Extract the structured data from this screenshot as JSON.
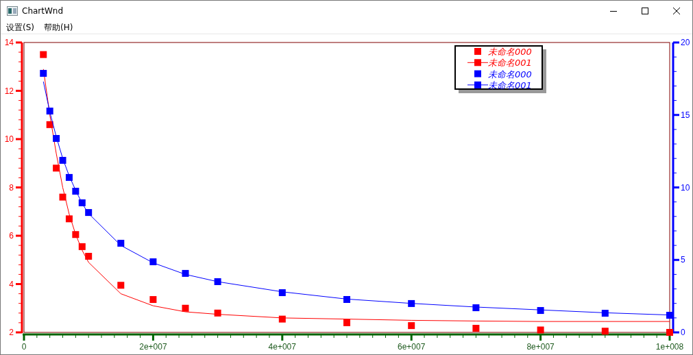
{
  "window": {
    "title": "ChartWnd"
  },
  "menu": [
    {
      "label": "设置(S)"
    },
    {
      "label": "帮助(H)"
    }
  ],
  "chart": {
    "chart_data": {
      "type": "scatter",
      "x": [
        3000000,
        4000000,
        5000000,
        6000000,
        7000000,
        8000000,
        9000000,
        10000000,
        15000000,
        20000000,
        25000000,
        30000000,
        40000000,
        50000000,
        60000000,
        70000000,
        80000000,
        90000000,
        100000000
      ],
      "xlim": [
        0,
        100000000
      ],
      "xticks": [
        {
          "value": 0,
          "label": "0"
        },
        {
          "value": 20000000,
          "label": "2e+007"
        },
        {
          "value": 40000000,
          "label": "4e+007"
        },
        {
          "value": 60000000,
          "label": "6e+007"
        },
        {
          "value": 80000000,
          "label": "8e+007"
        },
        {
          "value": 100000000,
          "label": "1e+008"
        }
      ],
      "ylim": [
        2,
        14
      ],
      "yticks": [
        2,
        4,
        6,
        8,
        10,
        12,
        14
      ],
      "legend": "top right",
      "y2lim": [
        0,
        20
      ],
      "y2ticks": [
        0,
        5,
        10,
        15,
        20
      ],
      "series": [
        {
          "name": "未命名000",
          "color": "#ff0000",
          "type": "scatter",
          "values": [
            13.5,
            10.6,
            8.8,
            7.6,
            6.7,
            6.05,
            5.55,
            5.15,
            3.95,
            3.36,
            3.0,
            2.8,
            2.55,
            2.4,
            2.28,
            2.17,
            2.1,
            2.05,
            2.0
          ]
        },
        {
          "name": "未命名001",
          "color": "#ff0000",
          "type": "line",
          "values": [
            12.9,
            11.0,
            9.4,
            8.0,
            6.9,
            6.05,
            5.4,
            4.9,
            3.6,
            3.1,
            2.85,
            2.75,
            2.6,
            2.55,
            2.5,
            2.47,
            2.45,
            2.45,
            2.45
          ]
        },
        {
          "name": "未命名000",
          "color": "#0000ff",
          "type": "scatter",
          "axis": "y2",
          "values": [
            17.87,
            15.27,
            13.38,
            11.87,
            10.69,
            9.74,
            8.94,
            8.27,
            6.15,
            4.87,
            4.07,
            3.5,
            2.74,
            2.27,
            1.99,
            1.7,
            1.51,
            1.32,
            1.18
          ]
        },
        {
          "name": "未命名001",
          "color": "#0000ff",
          "type": "line",
          "axis": "y2",
          "values": [
            17.3,
            15.2,
            13.5,
            12.0,
            10.8,
            9.8,
            8.9,
            8.2,
            6.0,
            4.8,
            4.0,
            3.5,
            2.8,
            2.3,
            2.0,
            1.75,
            1.55,
            1.35,
            1.2
          ]
        }
      ]
    }
  }
}
